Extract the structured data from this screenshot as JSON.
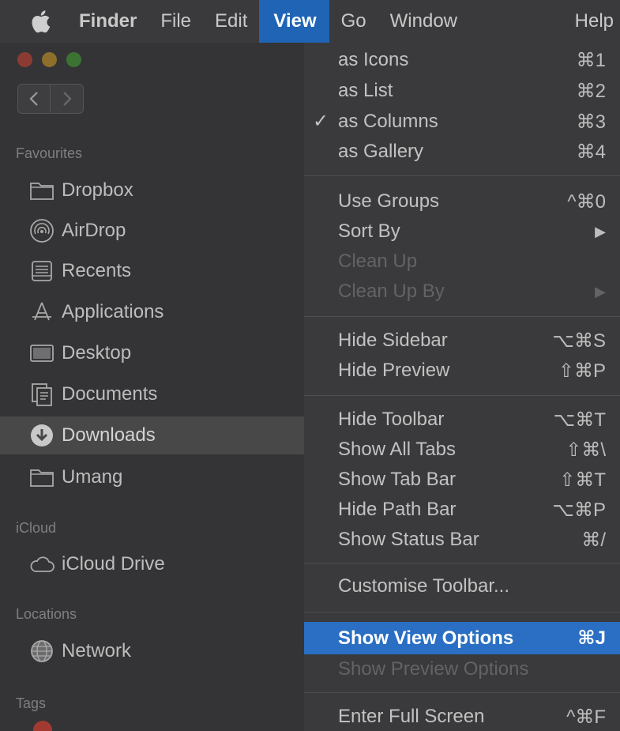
{
  "menubar": {
    "items": [
      "Finder",
      "File",
      "Edit",
      "View",
      "Go",
      "Window",
      "Help"
    ]
  },
  "sidebar": {
    "sections": {
      "favourites": "Favourites",
      "icloud": "iCloud",
      "locations": "Locations",
      "tags": "Tags"
    },
    "items": {
      "dropbox": "Dropbox",
      "airdrop": "AirDrop",
      "recents": "Recents",
      "applications": "Applications",
      "desktop": "Desktop",
      "documents": "Documents",
      "downloads": "Downloads",
      "umang": "Umang",
      "icloud_drive": "iCloud Drive",
      "network": "Network"
    },
    "selected": "Downloads"
  },
  "view_menu": {
    "items": [
      {
        "label": "as Icons",
        "shortcut": "⌘1"
      },
      {
        "label": "as List",
        "shortcut": "⌘2"
      },
      {
        "label": "as Columns",
        "shortcut": "⌘3",
        "checked": true
      },
      {
        "label": "as Gallery",
        "shortcut": "⌘4"
      },
      {
        "label": "Use Groups",
        "shortcut": "^⌘0"
      },
      {
        "label": "Sort By",
        "shortcut": "▶"
      },
      {
        "label": "Clean Up",
        "shortcut": "",
        "disabled": true
      },
      {
        "label": "Clean Up By",
        "shortcut": "▶",
        "disabled": true
      },
      {
        "label": "Hide Sidebar",
        "shortcut": "⌥⌘S"
      },
      {
        "label": "Hide Preview",
        "shortcut": "⇧⌘P"
      },
      {
        "label": "Hide Toolbar",
        "shortcut": "⌥⌘T"
      },
      {
        "label": "Show All Tabs",
        "shortcut": "⇧⌘\\"
      },
      {
        "label": "Show Tab Bar",
        "shortcut": "⇧⌘T"
      },
      {
        "label": "Hide Path Bar",
        "shortcut": "⌥⌘P"
      },
      {
        "label": "Show Status Bar",
        "shortcut": "⌘/"
      },
      {
        "label": "Customise Toolbar...",
        "shortcut": ""
      },
      {
        "label": "Show View Options",
        "shortcut": "⌘J",
        "highlighted": true
      },
      {
        "label": "Show Preview Options",
        "shortcut": "",
        "disabled": true
      },
      {
        "label": "Enter Full Screen",
        "shortcut": "^⌘F"
      }
    ],
    "check_mark": "✓"
  },
  "colors": {
    "menu_highlight": "#2a6fc4",
    "menubar_active": "#1f64b5",
    "tag_red": "#a33a32"
  }
}
